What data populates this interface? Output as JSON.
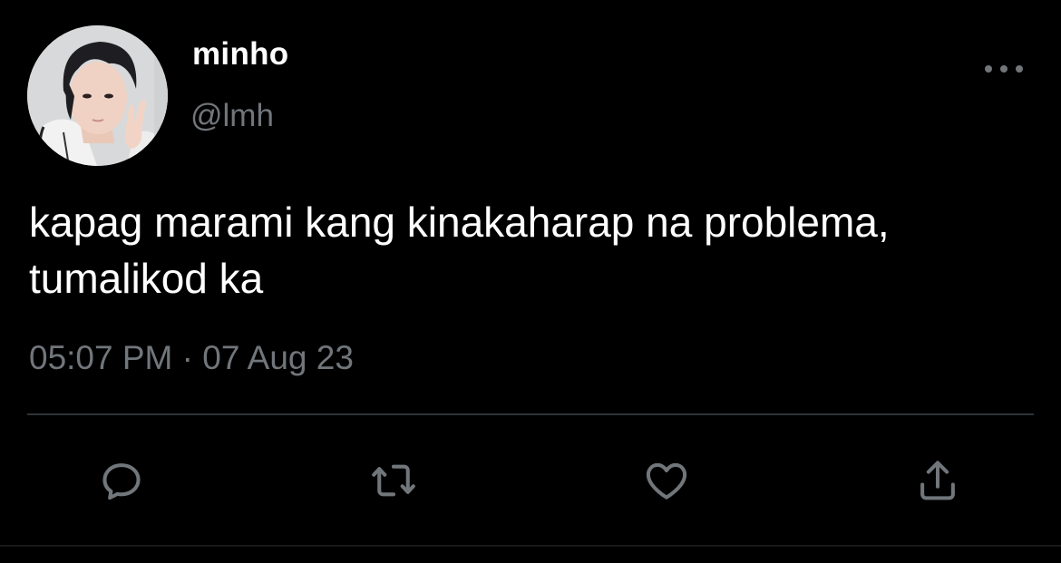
{
  "user": {
    "display_name": "minho",
    "handle": "@lmh"
  },
  "tweet": {
    "text": "kapag marami kang kinakaharap na problema, tumalikod ka",
    "timestamp": "05:07 PM · 07 Aug 23"
  },
  "actions": {
    "reply_icon": "reply-icon",
    "retweet_icon": "retweet-icon",
    "like_icon": "heart-icon",
    "share_icon": "share-icon",
    "more_icon": "more-icon"
  },
  "colors": {
    "background": "#000000",
    "primary_text": "#ffffff",
    "secondary_text": "#71767b",
    "divider": "#2f3336"
  }
}
